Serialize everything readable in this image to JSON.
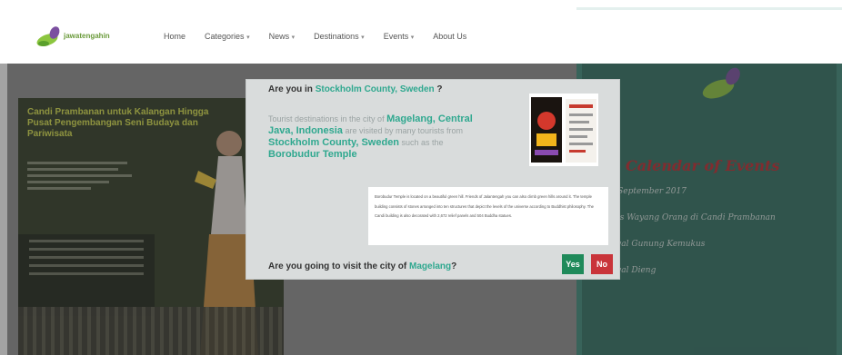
{
  "header": {
    "logo_text": "jawatengahin",
    "nav": [
      {
        "label": "Home",
        "has_dropdown": false
      },
      {
        "label": "Categories",
        "has_dropdown": true
      },
      {
        "label": "News",
        "has_dropdown": true
      },
      {
        "label": "Destinations",
        "has_dropdown": true
      },
      {
        "label": "Events",
        "has_dropdown": true
      },
      {
        "label": "About Us",
        "has_dropdown": false
      }
    ]
  },
  "slide": {
    "title": "Candi Prambanan untuk Kalangan Hingga Pusat Pengembangan Seni Budaya dan Pariwisata"
  },
  "events": {
    "title": "Calendar of Events",
    "items": [
      {
        "date": "",
        "name": "1 - 2 September 2017"
      },
      {
        "date": "",
        "name": "Pentas Wayang Orang di Candi Prambanan"
      },
      {
        "date": "",
        "name": "Festival Gunung Kemukus"
      },
      {
        "date": "",
        "name": "Festival Dieng"
      }
    ]
  },
  "modal": {
    "question_prefix": "Are you in ",
    "location": "Stockholm County, Sweden",
    "question_suffix": " ?",
    "desc_part1": "Tourist destinations in the city of ",
    "desc_city": "Magelang, Central Java, Indonesia",
    "desc_part2": " are visited by many tourists from ",
    "desc_origin": "Stockholm County, Sweden",
    "desc_part3": " such as the ",
    "desc_place": "Borobudur Temple",
    "info_text": "Borobudur Temple is located on a beautiful green hill. Friends of Jalantengah you can also climb green hills around it. The temple building consists of stones arranged into ten structures that depict the levels of the universe according to Buddhist philosophy. The Candi building is also decorated with 2,672 relief panels and 504 Buddha statues.",
    "visit_prefix": "Are you going to visit the city of ",
    "visit_city": "Magelang",
    "visit_suffix": "?",
    "yes_label": "Yes",
    "no_label": "No"
  },
  "colors": {
    "accent": "#2fa88f",
    "events_bg": "#3d8b7a",
    "events_title": "#c1272d",
    "yes_button": "#1f8a5a",
    "no_button": "#c9343a"
  }
}
